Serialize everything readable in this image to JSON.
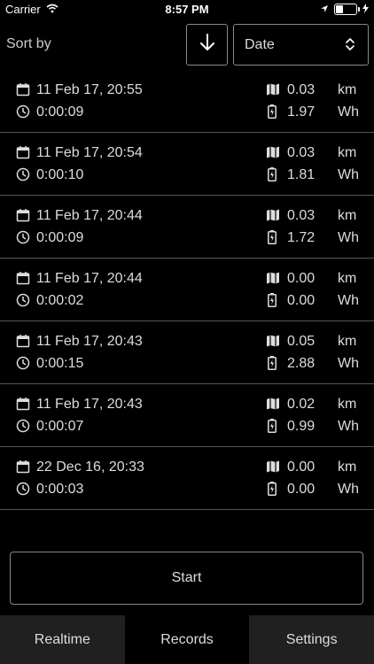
{
  "status_bar": {
    "carrier": "Carrier",
    "time": "8:57 PM"
  },
  "sort": {
    "label": "Sort by",
    "direction_icon": "arrow-down-icon",
    "selected": "Date"
  },
  "records": [
    {
      "date": "11 Feb 17, 20:55",
      "duration": "0:00:09",
      "distance": "0.03",
      "distance_unit": "km",
      "energy": "1.97",
      "energy_unit": "Wh"
    },
    {
      "date": "11 Feb 17, 20:54",
      "duration": "0:00:10",
      "distance": "0.03",
      "distance_unit": "km",
      "energy": "1.81",
      "energy_unit": "Wh"
    },
    {
      "date": "11 Feb 17, 20:44",
      "duration": "0:00:09",
      "distance": "0.03",
      "distance_unit": "km",
      "energy": "1.72",
      "energy_unit": "Wh"
    },
    {
      "date": "11 Feb 17, 20:44",
      "duration": "0:00:02",
      "distance": "0.00",
      "distance_unit": "km",
      "energy": "0.00",
      "energy_unit": "Wh"
    },
    {
      "date": "11 Feb 17, 20:43",
      "duration": "0:00:15",
      "distance": "0.05",
      "distance_unit": "km",
      "energy": "2.88",
      "energy_unit": "Wh"
    },
    {
      "date": "11 Feb 17, 20:43",
      "duration": "0:00:07",
      "distance": "0.02",
      "distance_unit": "km",
      "energy": "0.99",
      "energy_unit": "Wh"
    },
    {
      "date": "22 Dec 16, 20:33",
      "duration": "0:00:03",
      "distance": "0.00",
      "distance_unit": "km",
      "energy": "0.00",
      "energy_unit": "Wh"
    }
  ],
  "start_button": "Start",
  "tabs": [
    {
      "label": "Realtime"
    },
    {
      "label": "Records"
    },
    {
      "label": "Settings"
    }
  ]
}
